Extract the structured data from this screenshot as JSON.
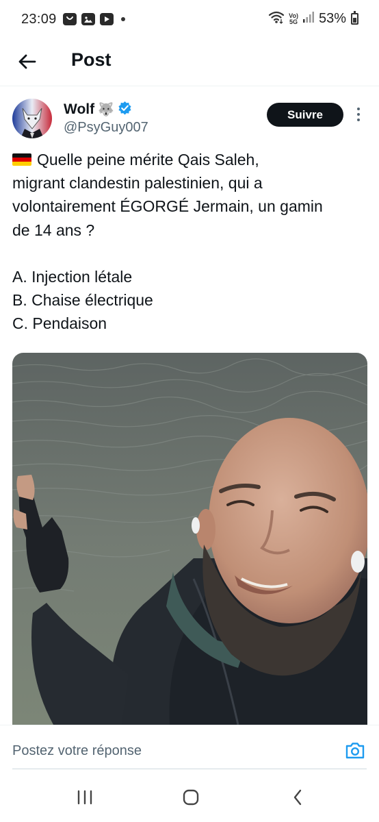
{
  "status_bar": {
    "time": "23:09",
    "network_badge_top": "Vo)",
    "network_badge_bottom": "5G",
    "battery": "53%",
    "battery_level": 0.53
  },
  "header": {
    "title": "Post",
    "back_icon": "arrow-left-icon"
  },
  "post": {
    "author": {
      "name": "Wolf",
      "emoji": "🐺",
      "verified": true,
      "handle": "@PsyGuy007"
    },
    "follow_label": "Suivre",
    "text_lines": [
      "Quelle peine mérite Qais Saleh,",
      "migrant clandestin palestinien, qui a",
      "volontairement ÉGORGÉ Jermain, un gamin",
      "de 14 ans ?"
    ],
    "options": [
      "A. Injection létale",
      "B. Chaise électrique",
      "C. Pendaison"
    ]
  },
  "reply": {
    "placeholder": "Postez votre réponse"
  },
  "colors": {
    "text_primary": "#0f1419",
    "text_secondary": "#536471",
    "follow_bg": "#0f1419",
    "accent": "#1d9bf0"
  }
}
